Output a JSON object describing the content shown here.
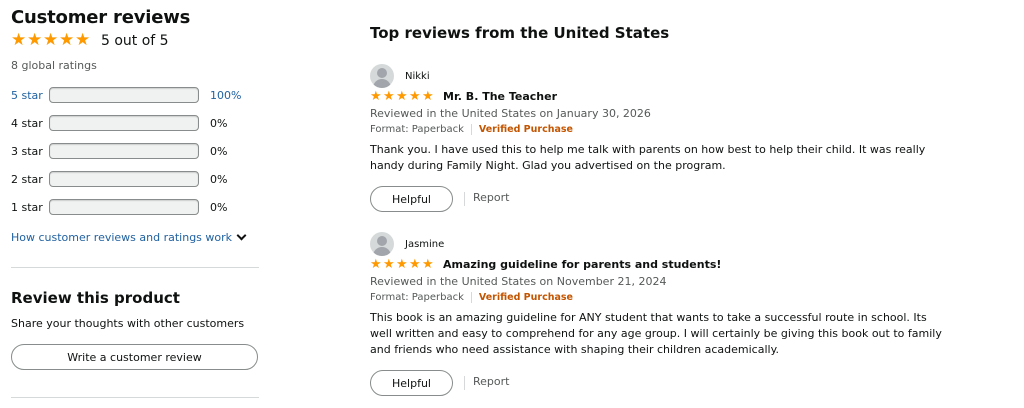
{
  "summary": {
    "title": "Customer reviews",
    "rating_text": "5 out of 5",
    "rating_value": 5,
    "global_ratings": "8 global ratings",
    "histogram": [
      {
        "label": "5 star",
        "pct": "100%",
        "fraction": 1.0,
        "active": true
      },
      {
        "label": "4 star",
        "pct": "0%",
        "fraction": 0,
        "active": false
      },
      {
        "label": "3 star",
        "pct": "0%",
        "fraction": 0,
        "active": false
      },
      {
        "label": "2 star",
        "pct": "0%",
        "fraction": 0,
        "active": false
      },
      {
        "label": "1 star",
        "pct": "0%",
        "fraction": 0,
        "active": false
      }
    ],
    "how_link": "How customer reviews and ratings work"
  },
  "review_product": {
    "title": "Review this product",
    "subtitle": "Share your thoughts with other customers",
    "button": "Write a customer review"
  },
  "reviews_section": {
    "title": "Top reviews from the United States",
    "reviews": [
      {
        "name": "Nikki",
        "stars": 5,
        "title": "Mr. B. The Teacher",
        "date": "Reviewed in the United States on January 30, 2026",
        "format": "Format: Paperback",
        "verified": "Verified Purchase",
        "body": "Thank you. I have used this to help me talk with parents on how best to help their child. It was really handy during Family Night. Glad you advertised on the program.",
        "helpful": "Helpful",
        "report": "Report"
      },
      {
        "name": "Jasmine",
        "stars": 5,
        "title": "Amazing guideline for parents and students!",
        "date": "Reviewed in the United States on November 21, 2024",
        "format": "Format: Paperback",
        "verified": "Verified Purchase",
        "body": "This book is an amazing guideline for ANY student that wants to take a successful route in school. Its well written and easy to comprehend for any age group. I will certainly be giving this book out to family and friends who need assistance with shaping their children academically.",
        "helpful": "Helpful",
        "report": "Report"
      }
    ]
  },
  "colors": {
    "star": "#FF9900",
    "bar_fill": "#FF7D00",
    "link": "#2162A1",
    "verified": "#C45500"
  }
}
